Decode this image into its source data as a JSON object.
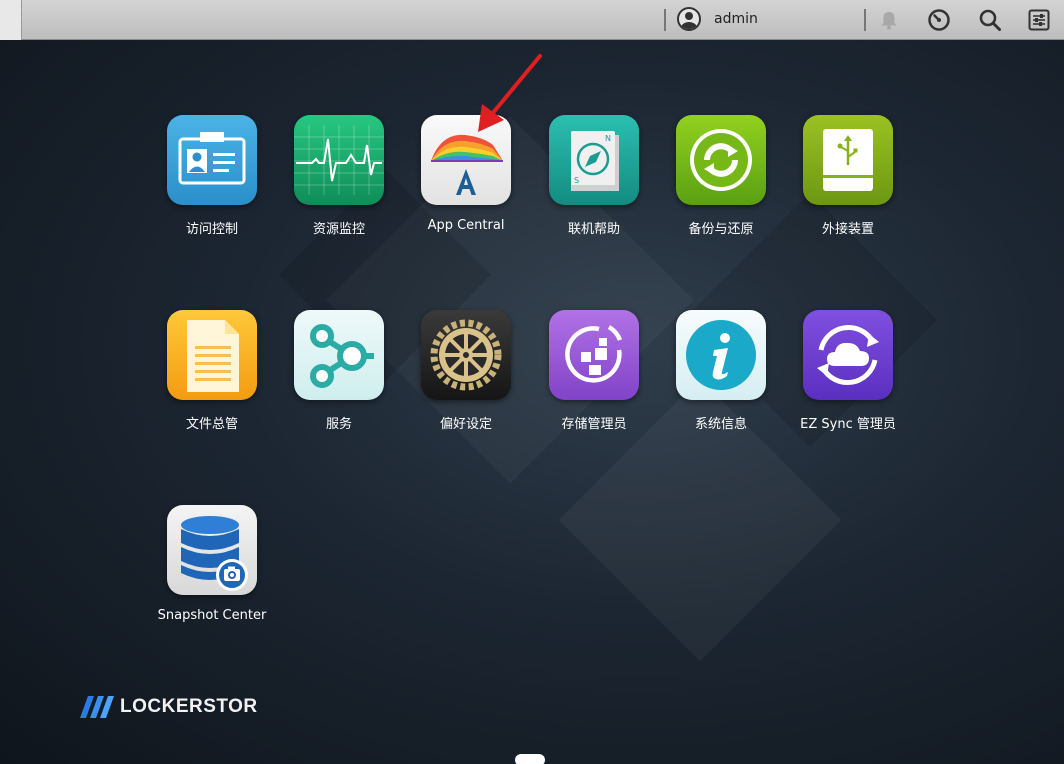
{
  "topbar": {
    "user_name": "admin",
    "icons": [
      "user-icon",
      "bell-icon",
      "gauge-icon",
      "search-icon",
      "settings-sliders-icon"
    ]
  },
  "apps": [
    {
      "label": "访问控制",
      "icon": "access-control-icon",
      "color": "#3aa0d8"
    },
    {
      "label": "资源监控",
      "icon": "resource-monitor-icon",
      "color": "#1fae6e"
    },
    {
      "label": "App Central",
      "icon": "app-central-icon",
      "color": "#f2f2f2"
    },
    {
      "label": "联机帮助",
      "icon": "online-help-icon",
      "color": "#1fa79a"
    },
    {
      "label": "备份与还原",
      "icon": "backup-restore-icon",
      "color": "#7ac01e"
    },
    {
      "label": "外接装置",
      "icon": "external-device-icon",
      "color": "#86b31c"
    },
    {
      "label": "文件总管",
      "icon": "file-explorer-icon",
      "color": "#f6b21d"
    },
    {
      "label": "服务",
      "icon": "services-icon",
      "color": "#dff2f2"
    },
    {
      "label": "偏好设定",
      "icon": "preferences-icon",
      "color": "#2a2a2a"
    },
    {
      "label": "存储管理员",
      "icon": "storage-manager-icon",
      "color": "#9a5ad6"
    },
    {
      "label": "系统信息",
      "icon": "system-info-icon",
      "color": "#e8f6f8"
    },
    {
      "label": "EZ Sync 管理员",
      "icon": "ez-sync-icon",
      "color": "#6d3fd0"
    },
    {
      "label": "Snapshot Center",
      "icon": "snapshot-center-icon",
      "color": "#e6e6e6"
    }
  ],
  "brand": {
    "name": "LOCKERSTOR"
  }
}
